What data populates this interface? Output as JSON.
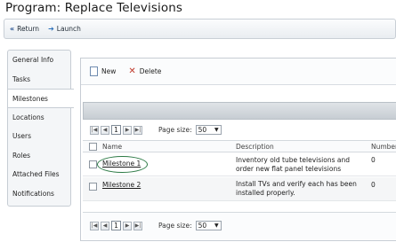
{
  "page": {
    "title": "Program: Replace Televisions"
  },
  "toolbar": {
    "return_label": "Return",
    "launch_label": "Launch"
  },
  "sidebar": {
    "items": [
      {
        "label": "General Info",
        "active": false
      },
      {
        "label": "Tasks",
        "active": false
      },
      {
        "label": "Milestones",
        "active": true
      },
      {
        "label": "Locations",
        "active": false
      },
      {
        "label": "Users",
        "active": false
      },
      {
        "label": "Roles",
        "active": false
      },
      {
        "label": "Attached Files",
        "active": false
      },
      {
        "label": "Notifications",
        "active": false
      }
    ]
  },
  "actions": {
    "new_label": "New",
    "delete_label": "Delete"
  },
  "pager": {
    "page_number": "1",
    "page_size_label": "Page size:",
    "page_size_value": "50"
  },
  "grid": {
    "columns": {
      "name": "Name",
      "description": "Description",
      "number": "Number"
    },
    "rows": [
      {
        "name": "Milestone 1",
        "description": "Inventory old tube televisions and order new flat panel televisions",
        "number": "0"
      },
      {
        "name": "Milestone 2",
        "description": "Install TVs and verify each has been installed properly.",
        "number": "0"
      }
    ]
  }
}
